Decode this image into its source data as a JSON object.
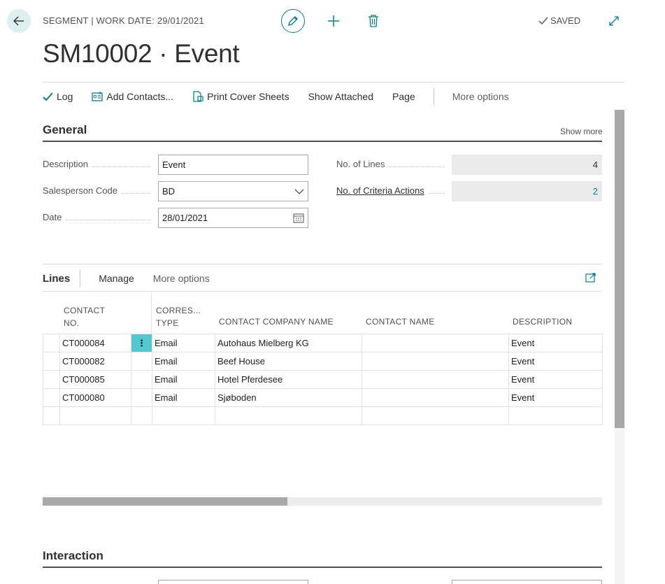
{
  "header": {
    "breadcrumb": "SEGMENT | WORK DATE: 29/01/2021",
    "status": "SAVED",
    "title": "SM10002 · Event",
    "icons": [
      "back-arrow-icon",
      "edit-pencil-icon",
      "plus-icon",
      "trash-icon",
      "check-icon",
      "expand-icon"
    ]
  },
  "actions": {
    "log": "Log",
    "add_contacts": "Add Contacts...",
    "print_cover_sheets": "Print Cover Sheets",
    "show_attached": "Show Attached",
    "page": "Page",
    "more_options": "More options"
  },
  "general": {
    "title": "General",
    "show_more": "Show more",
    "description_label": "Description",
    "description_value": "Event",
    "salesperson_label": "Salesperson Code",
    "salesperson_value": "BD",
    "date_label": "Date",
    "date_value": "28/01/2021",
    "no_of_lines_label": "No. of Lines",
    "no_of_lines_value": "4",
    "criteria_label": "No. of Criteria Actions",
    "criteria_value": "2"
  },
  "lines": {
    "title": "Lines",
    "manage": "Manage",
    "more_options": "More options",
    "columns": {
      "contact_no_1": "CONTACT",
      "contact_no_2": "NO.",
      "corres_1": "CORRES...",
      "corres_2": "TYPE",
      "company": "CONTACT COMPANY NAME",
      "contact_name": "CONTACT NAME",
      "description": "DESCRIPTION"
    },
    "rows": [
      {
        "contact_no": "CT000084",
        "type": "Email",
        "company": "Autohaus Mielberg KG",
        "contact_name": "",
        "description": "Event"
      },
      {
        "contact_no": "CT000082",
        "type": "Email",
        "company": "Beef House",
        "contact_name": "",
        "description": "Event"
      },
      {
        "contact_no": "CT000085",
        "type": "Email",
        "company": "Hotel Pferdesee",
        "contact_name": "",
        "description": "Event"
      },
      {
        "contact_no": "CT000080",
        "type": "Email",
        "company": "Sjøboden",
        "contact_name": "",
        "description": "Event"
      }
    ],
    "row_menu_glyph": "⋮"
  },
  "interaction": {
    "title": "Interaction"
  },
  "colors": {
    "accent": "#0e7b87",
    "row_menu": "#55c8cf",
    "readonly_bg": "#eaeaea"
  }
}
